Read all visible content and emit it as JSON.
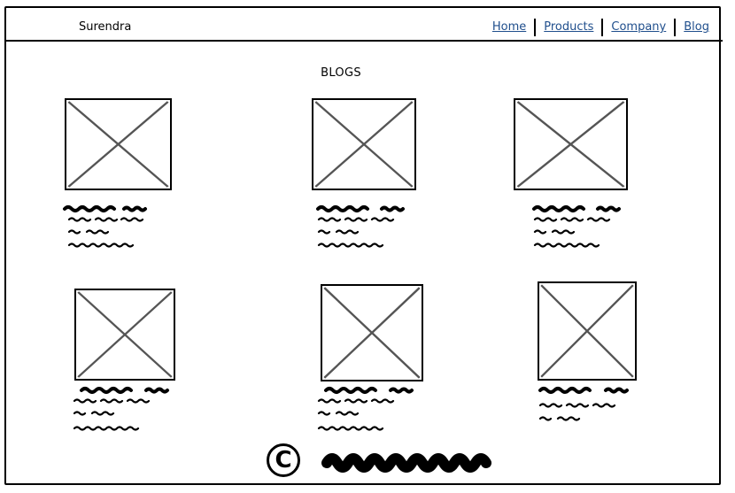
{
  "header": {
    "brand": "Surendra",
    "nav": [
      {
        "label": "Home"
      },
      {
        "label": "Products"
      },
      {
        "label": "Company"
      },
      {
        "label": "Blog"
      }
    ]
  },
  "main": {
    "title": "BLOGS",
    "cards_count": 6
  },
  "footer": {
    "copyright_symbol": "C"
  },
  "icons": {
    "thumbnail": "image-placeholder-icon",
    "copyright": "copyright-icon"
  }
}
